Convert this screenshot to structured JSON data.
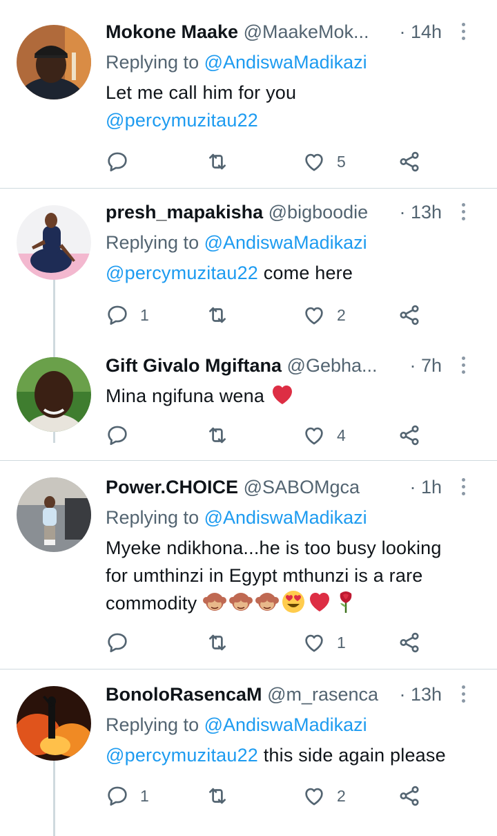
{
  "tweets": [
    {
      "name": "Mokone Maake",
      "handle": "@MaakeMok...",
      "time": "· 14h",
      "replying_label": "Replying to",
      "replying_to": "@AndiswaMadikazi",
      "text_line1": "Let me call him for you",
      "mention": "@percymuzitau22",
      "reply_count": "",
      "retweet_count": "",
      "like_count": "5"
    },
    {
      "name": "presh_mapakisha",
      "handle": "@bigboodie",
      "time": "· 13h",
      "replying_label": "Replying to",
      "replying_to": "@AndiswaMadikazi",
      "mention": "@percymuzitau22",
      "text_after": " come here",
      "reply_count": "1",
      "retweet_count": "",
      "like_count": "2"
    },
    {
      "name": "Gift Givalo Mgiftana",
      "handle": "@Gebha...",
      "time": "· 7h",
      "text": "Mina ngifuna wena",
      "reply_count": "",
      "retweet_count": "",
      "like_count": "4"
    },
    {
      "name": "Power.CHOICE",
      "handle": "@SABOMgca",
      "time": "· 1h",
      "replying_label": "Replying to",
      "replying_to": "@AndiswaMadikazi",
      "text_line1": "Myeke ndikhona...he is too busy looking",
      "text_line2": "for umthinzi in Egypt mthunzi is a rare",
      "text_line3": "commodity",
      "reply_count": "",
      "retweet_count": "",
      "like_count": "1"
    },
    {
      "name": "BonoloRasencaM",
      "handle": "@m_rasenca",
      "time": "· 13h",
      "replying_label": "Replying to",
      "replying_to": "@AndiswaMadikazi",
      "mention": "@percymuzitau22",
      "text_after": " this side again please",
      "reply_count": "1",
      "retweet_count": "",
      "like_count": "2"
    }
  ],
  "colors": {
    "link": "#1d9bf0",
    "secondary_text": "#536471",
    "divider": "#cfd9de",
    "heart_emoji": "#e0245e"
  },
  "icons": [
    "reply-icon",
    "retweet-icon",
    "like-icon",
    "share-icon",
    "more-icon"
  ]
}
